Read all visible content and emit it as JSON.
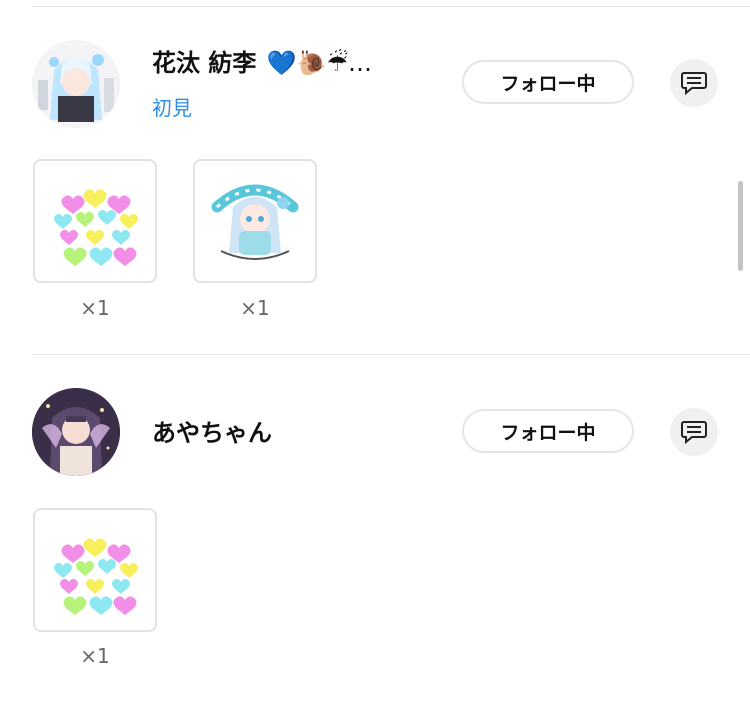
{
  "entries": [
    {
      "name": "花汰 紡李",
      "name_emojis": "💙🐌☔…",
      "tag": "初見",
      "follow_label": "フォロー中",
      "gifts": [
        {
          "kind": "hearts",
          "count": "×1"
        },
        {
          "kind": "chibi-sticker",
          "count": "×1"
        }
      ]
    },
    {
      "name": "あやちゃん",
      "follow_label": "フォロー中",
      "gifts": [
        {
          "kind": "hearts",
          "count": "×1"
        }
      ]
    }
  ],
  "colors": {
    "tag_blue": "#2f8ee6",
    "button_border": "#e4e4e4",
    "divider": "#e6e6e6"
  }
}
